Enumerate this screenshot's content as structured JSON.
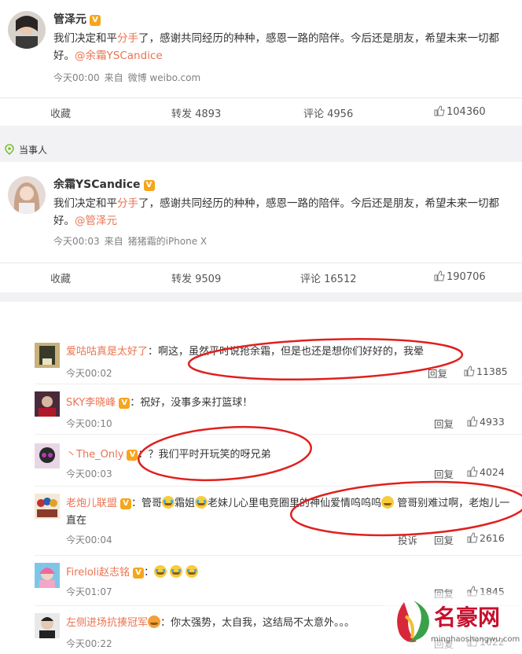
{
  "post1": {
    "author": "管泽元",
    "verified_badge": "V",
    "text_a": "我们决定和平",
    "text_red": "分手",
    "text_b": "了，感谢共同经历的种种，感恩一路的陪伴。今后还是朋友，希望未来一切都好。",
    "mention": "@余霜YSCandice",
    "time": "今天00:00",
    "source_prefix": "来自",
    "source": "微博 weibo.com",
    "collect_label": "收藏",
    "repost_label": "转发 4893",
    "comment_label": "评论 4956",
    "like_count": "104360"
  },
  "tag": {
    "label": "当事人",
    "icon": "location-pin-icon"
  },
  "post2": {
    "author": "余霜YSCandice",
    "verified_badge": "V",
    "text_a": "我们决定和平",
    "text_red": "分手",
    "text_b": "了，感谢共同经历的种种，感恩一路的陪伴。今后还是朋友，希望未来一切都好。",
    "mention": "@管泽元",
    "time": "今天00:03",
    "source_prefix": "来自",
    "source": "猪猪霜的iPhone X",
    "collect_label": "收藏",
    "repost_label": "转发 9509",
    "comment_label": "评论 16512",
    "like_count": "190706"
  },
  "comments": [
    {
      "user": "爱咕咕真是太好了",
      "text": "：啊这，虽然平时说抢余霜，但是也还是想你们好好的，我晕",
      "time": "今天00:02",
      "reply": "回复",
      "likes": "11385"
    },
    {
      "user": "SKY李晓峰",
      "badge": "V",
      "text": "：祝好，没事多来打篮球！",
      "time": "今天00:10",
      "reply": "回复",
      "likes": "4933"
    },
    {
      "user": "丶The_Only",
      "badge": "V",
      "text": "：？我们平时开玩笑的呀兄弟",
      "time": "今天00:03",
      "reply": "回复",
      "likes": "4024"
    },
    {
      "user": "老炮儿联盟",
      "badge": "V",
      "text_a": "：管哥",
      "text_b": "霜姐",
      "text_c": "老妹儿心里电竞圈里的神仙爱情呜呜呜",
      "text_d": "管哥别难过啊，老炮儿一直在",
      "time": "今天00:04",
      "report": "投诉",
      "reply": "回复",
      "likes": "2616"
    },
    {
      "user": "Fireloli赵志铭",
      "badge": "V",
      "text": "：",
      "time": "今天01:07",
      "reply": "回复",
      "likes": "1845"
    },
    {
      "user": "左侧进场抗揍冠军",
      "text": "：你太强势，太自我，这结局不太意外。。。",
      "time": "今天00:22",
      "reply": "回复",
      "likes": "1022"
    }
  ],
  "watermark": {
    "brand": "名豪网",
    "url": "minghaoshangwu.com"
  },
  "colors": {
    "accent": "#eb7350",
    "verified": "#f7a51b",
    "annotation": "#e0201e"
  }
}
